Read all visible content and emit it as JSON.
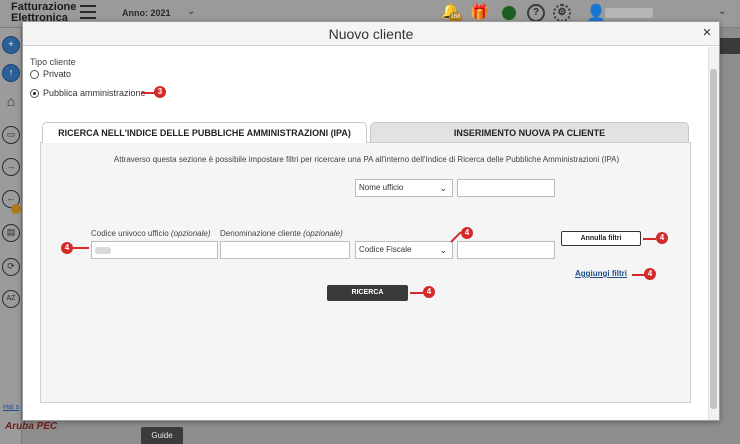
{
  "app": {
    "brand": "Fatturazione Elettronica",
    "year_label": "Anno: 2021",
    "notification_count": "168",
    "side_link": "Hai s",
    "footer_brand": "Aruba PEC",
    "guide_tab": "Guide"
  },
  "modal": {
    "title": "Nuovo cliente",
    "tipo_cliente_label": "Tipo cliente",
    "radio_options": [
      {
        "label": "Privato",
        "selected": false
      },
      {
        "label": "Pubblica amministrazione",
        "selected": true
      }
    ],
    "tabs": [
      {
        "label": "RICERCA NELL'INDICE DELLE PUBBLICHE AMMINISTRAZIONI (IPA)",
        "active": true
      },
      {
        "label": "INSERIMENTO NUOVA PA CLIENTE",
        "active": false
      }
    ],
    "intro": "Attraverso questa sezione è possibile impostare filtri per ricercare una PA all'interno dell'Indice di Ricerca delle Pubbliche Amministrazioni (IPA)",
    "fields": {
      "codice_label": "Codice univoco ufficio",
      "codice_optional": "(opzionale)",
      "denominazione_label": "Denominazione cliente",
      "denominazione_optional": "(opzionale)"
    },
    "filters": [
      {
        "selected": "Nome ufficio",
        "value": ""
      },
      {
        "selected": "Codice Fiscale",
        "value": ""
      }
    ],
    "buttons": {
      "annulla": "Annulla filtri",
      "aggiungi": "Aggiungi filtri",
      "ricerca": "RICERCA"
    },
    "markers": [
      "3",
      "4",
      "4",
      "4",
      "4",
      "4"
    ],
    "close_icon": "×"
  },
  "colors": {
    "marker": "#d32a2a",
    "primary_dark": "#3a3a3a",
    "link": "#1e4f86"
  }
}
